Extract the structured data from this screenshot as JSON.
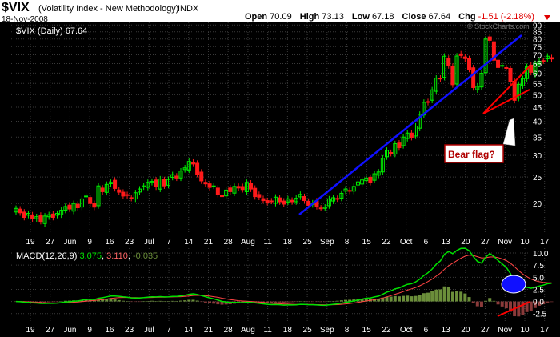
{
  "header": {
    "symbol": "$VIX",
    "description": "(Volatility Index - New Methodology)",
    "exchange": "INDX",
    "date": "18-Nov-2008",
    "open_label": "Open",
    "open": "70.09",
    "high_label": "High",
    "high": "73.13",
    "low_label": "Low",
    "low": "67.18",
    "close_label": "Close",
    "close": "67.64",
    "chg_label": "Chg",
    "chg": "-1.51 (-2.18%)",
    "watermark": "© StockCharts.com"
  },
  "colors": {
    "up": "#00ee00",
    "down": "#ff1a1a",
    "trendline": "#1010ff",
    "flag": "#ff0000",
    "macd_line": "#00e000",
    "signal_line": "#ff4444",
    "histogram": "#6b8e3a",
    "highlight": "#1010ff",
    "text": "#ffffff",
    "background": "#000000",
    "grid": "#3a3a3a"
  },
  "chart_data": [
    {
      "type": "candlestick",
      "legend": "$VIX (Daily) 67.64",
      "y_scale": "log",
      "ylim": [
        15.5,
        92
      ],
      "y_ticks": [
        90,
        85,
        80,
        75,
        70,
        65,
        60,
        55,
        50,
        45,
        40,
        35,
        30,
        25,
        20
      ],
      "x_tick_labels": [
        "19",
        "27",
        "Jun",
        "9",
        "16",
        "23",
        "Jul",
        "7",
        "14",
        "21",
        "28",
        "Aug",
        "11",
        "18",
        "25",
        "Sep",
        "8",
        "15",
        "22",
        "Oct",
        "6",
        "13",
        "20",
        "27",
        "Nov",
        "10",
        "17"
      ],
      "closes": [
        19.2,
        18.5,
        17.8,
        18.4,
        17.6,
        17.9,
        17.2,
        18.0,
        18.2,
        17.8,
        18.4,
        18.9,
        19.5,
        19.1,
        20.0,
        19.3,
        20.8,
        21.3,
        20.0,
        19.4,
        23.2,
        22.1,
        23.5,
        23.9,
        22.7,
        22.0,
        21.3,
        21.4,
        20.9,
        21.9,
        22.6,
        23.2,
        23.9,
        24.1,
        23.0,
        24.6,
        23.2,
        24.5,
        25.5,
        24.8,
        26.3,
        27.0,
        28.5,
        27.9,
        25.6,
        24.2,
        23.6,
        22.9,
        23.2,
        21.6,
        21.2,
        22.4,
        22.1,
        23.1,
        22.8,
        22.5,
        23.9,
        22.6,
        21.2,
        21.1,
        20.5,
        20.2,
        20.4,
        21.1,
        20.3,
        19.9,
        20.8,
        20.3,
        20.9,
        21.6,
        20.5,
        19.7,
        20.1,
        19.5,
        19.2,
        19.4,
        20.8,
        21.0,
        20.8,
        21.8,
        22.6,
        22.2,
        23.1,
        24.0,
        24.4,
        24.8,
        23.9,
        25.7,
        26.1,
        29.3,
        31.3,
        30.5,
        33.1,
        32.0,
        35.0,
        36.2,
        34.9,
        38.4,
        42.4,
        46.9,
        46.9,
        52.1,
        57.5,
        57.2,
        69.2,
        63.9,
        54.4,
        69.3,
        69.6,
        67.8,
        62.0,
        53.1,
        53.7,
        59.9,
        80.0,
        79.1,
        66.9,
        62.9,
        64.0,
        62.8,
        55.7,
        47.7,
        54.6,
        57.3,
        63.4,
        60.4,
        65.1,
        66.3,
        66.5,
        69.2,
        67.6
      ]
    },
    {
      "type": "line",
      "legend": "MACD(12,26,9) 3.075, 3.110, -0.035",
      "legend_name": "MACD(12,26,9)",
      "legend_macd": "3.075",
      "legend_signal": "3.110",
      "legend_hist": "-0.035",
      "ylim": [
        -4.2,
        11
      ],
      "y_ticks": [
        "10.0",
        "7.5",
        "5.0",
        "2.5",
        "0.0",
        "-2.5"
      ],
      "macd": [
        -0.0,
        -0.06,
        -0.16,
        -0.19,
        -0.28,
        -0.32,
        -0.4,
        -0.4,
        -0.38,
        -0.39,
        -0.33,
        -0.24,
        -0.12,
        -0.06,
        0.06,
        0.1,
        0.26,
        0.42,
        0.44,
        0.4,
        0.66,
        0.77,
        0.96,
        1.12,
        1.13,
        1.07,
        0.96,
        0.87,
        0.74,
        0.71,
        0.73,
        0.79,
        0.89,
        0.97,
        0.93,
        1.0,
        0.93,
        0.96,
        1.05,
        1.05,
        1.16,
        1.29,
        1.49,
        1.58,
        1.45,
        1.22,
        0.98,
        0.72,
        0.54,
        0.27,
        0.02,
        -0.09,
        -0.19,
        -0.19,
        -0.21,
        -0.25,
        -0.16,
        -0.18,
        -0.29,
        -0.38,
        -0.49,
        -0.58,
        -0.64,
        -0.63,
        -0.67,
        -0.74,
        -0.71,
        -0.72,
        -0.68,
        -0.59,
        -0.6,
        -0.66,
        -0.67,
        -0.72,
        -0.78,
        -0.8,
        -0.69,
        -0.58,
        -0.5,
        -0.35,
        -0.17,
        -0.06,
        0.1,
        0.3,
        0.49,
        0.67,
        0.73,
        0.93,
        1.1,
        1.48,
        1.93,
        2.2,
        2.6,
        2.81,
        3.19,
        3.54,
        3.67,
        4.03,
        4.6,
        5.37,
        5.92,
        6.71,
        7.69,
        8.37,
        9.76,
        10.33,
        9.88,
        10.54,
        10.95,
        10.99,
        10.47,
        9.25,
        8.26,
        7.91,
        9.14,
        9.89,
        9.32,
        8.44,
        7.75,
        7.03,
        5.78,
        4.1,
        3.29,
        2.83,
        2.93,
        2.73,
        2.95,
        3.19,
        3.36,
        3.66,
        3.75
      ],
      "signal": [
        -0.0,
        -0.01,
        -0.04,
        -0.07,
        -0.11,
        -0.16,
        -0.21,
        -0.25,
        -0.27,
        -0.3,
        -0.3,
        -0.29,
        -0.26,
        -0.22,
        -0.16,
        -0.11,
        -0.03,
        0.06,
        0.13,
        0.19,
        0.29,
        0.38,
        0.5,
        0.62,
        0.72,
        0.79,
        0.82,
        0.83,
        0.81,
        0.79,
        0.78,
        0.78,
        0.8,
        0.83,
        0.85,
        0.88,
        0.89,
        0.9,
        0.93,
        0.95,
        0.99,
        1.05,
        1.14,
        1.23,
        1.27,
        1.26,
        1.2,
        1.1,
        0.99,
        0.85,
        0.68,
        0.53,
        0.38,
        0.27,
        0.17,
        0.09,
        0.04,
        -0.0,
        -0.06,
        -0.12,
        -0.2,
        -0.27,
        -0.35,
        -0.4,
        -0.46,
        -0.51,
        -0.55,
        -0.59,
        -0.6,
        -0.6,
        -0.6,
        -0.61,
        -0.62,
        -0.64,
        -0.67,
        -0.7,
        -0.7,
        -0.67,
        -0.64,
        -0.58,
        -0.5,
        -0.41,
        -0.31,
        -0.19,
        -0.05,
        0.1,
        0.22,
        0.36,
        0.51,
        0.7,
        0.95,
        1.2,
        1.48,
        1.75,
        2.04,
        2.34,
        2.6,
        2.89,
        3.23,
        3.66,
        4.11,
        4.63,
        5.24,
        5.87,
        6.65,
        7.39,
        7.89,
        8.42,
        8.93,
        9.34,
        9.56,
        9.5,
        9.25,
        8.98,
        9.01,
        9.18,
        9.2,
        9.05,
        8.79,
        8.44,
        7.91,
        7.15,
        6.38,
        5.67,
        5.12,
        4.64,
        4.3,
        4.08,
        3.94,
        3.88,
        3.86
      ]
    }
  ]
}
